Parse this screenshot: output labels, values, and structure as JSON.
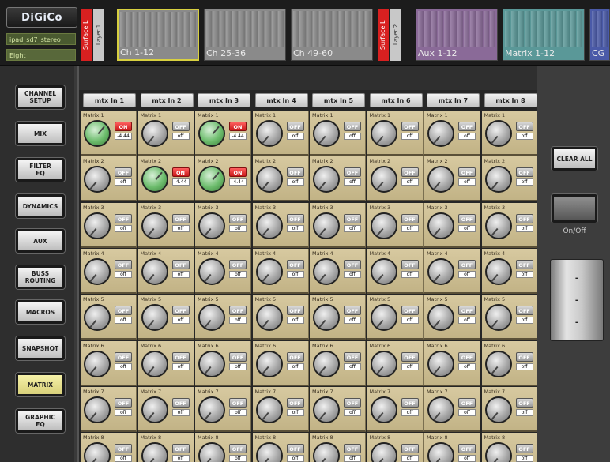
{
  "app": {
    "brand": "DiGiCo",
    "session_name": "ipad_sd7_stereo",
    "page_name": "Eight"
  },
  "banks": {
    "surface_left_1": "Surface L",
    "layer_1": "Layer 1",
    "surface_left_2": "Surface L",
    "layer_2": "Layer 2",
    "items": [
      {
        "label": "Ch 1-12",
        "color": "#8a8a8a",
        "selected": true
      },
      {
        "label": "Ch 25-36",
        "color": "#8a8a8a",
        "selected": false
      },
      {
        "label": "Ch 49-60",
        "color": "#8a8a8a",
        "selected": false
      },
      {
        "label": "Aux 1-12",
        "color": "#8a6a98",
        "selected": false
      },
      {
        "label": "Matrix 1-12",
        "color": "#5a9898",
        "selected": false
      },
      {
        "label": "CG",
        "color": "#4a5aa8",
        "selected": false
      }
    ]
  },
  "left_menu": [
    {
      "label": "CHANNEL\nSETUP",
      "active": false
    },
    {
      "label": "MIX",
      "active": false
    },
    {
      "label": "FILTER\nEQ",
      "active": false
    },
    {
      "label": "DYNAMICS",
      "active": false
    },
    {
      "label": "AUX",
      "active": false
    },
    {
      "label": "BUSS\nROUTING",
      "active": false
    },
    {
      "label": "MACROS",
      "active": false
    },
    {
      "label": "SNAPSHOT",
      "active": false
    },
    {
      "label": "MATRIX",
      "active": true
    },
    {
      "label": "GRAPHIC\nEQ",
      "active": false
    }
  ],
  "matrix": {
    "columns": [
      "mtx In 1",
      "mtx In 2",
      "mtx In 3",
      "mtx In 4",
      "mtx In 5",
      "mtx In 6",
      "mtx In 7",
      "mtx In 8"
    ],
    "rows": [
      "Matrix 1",
      "Matrix 2",
      "Matrix 3",
      "Matrix 4",
      "Matrix 5",
      "Matrix 6",
      "Matrix 7",
      "Matrix 8"
    ],
    "on_label": "ON",
    "off_label": "OFF",
    "on_value": "-4.44",
    "off_value": "off",
    "on_cells": [
      [
        0,
        0
      ],
      [
        0,
        2
      ],
      [
        1,
        1
      ],
      [
        1,
        2
      ]
    ]
  },
  "right_panel": {
    "clear_all": "CLEAR ALL",
    "onoff_label": "On/Off",
    "fader_ticks": [
      "-",
      "-",
      "-"
    ]
  },
  "colors": {
    "cell_bg": "#cdbf93",
    "on_red": "#d82020",
    "knob_on_green": "#6cbc6c",
    "selected_bank": "#d8d040"
  }
}
